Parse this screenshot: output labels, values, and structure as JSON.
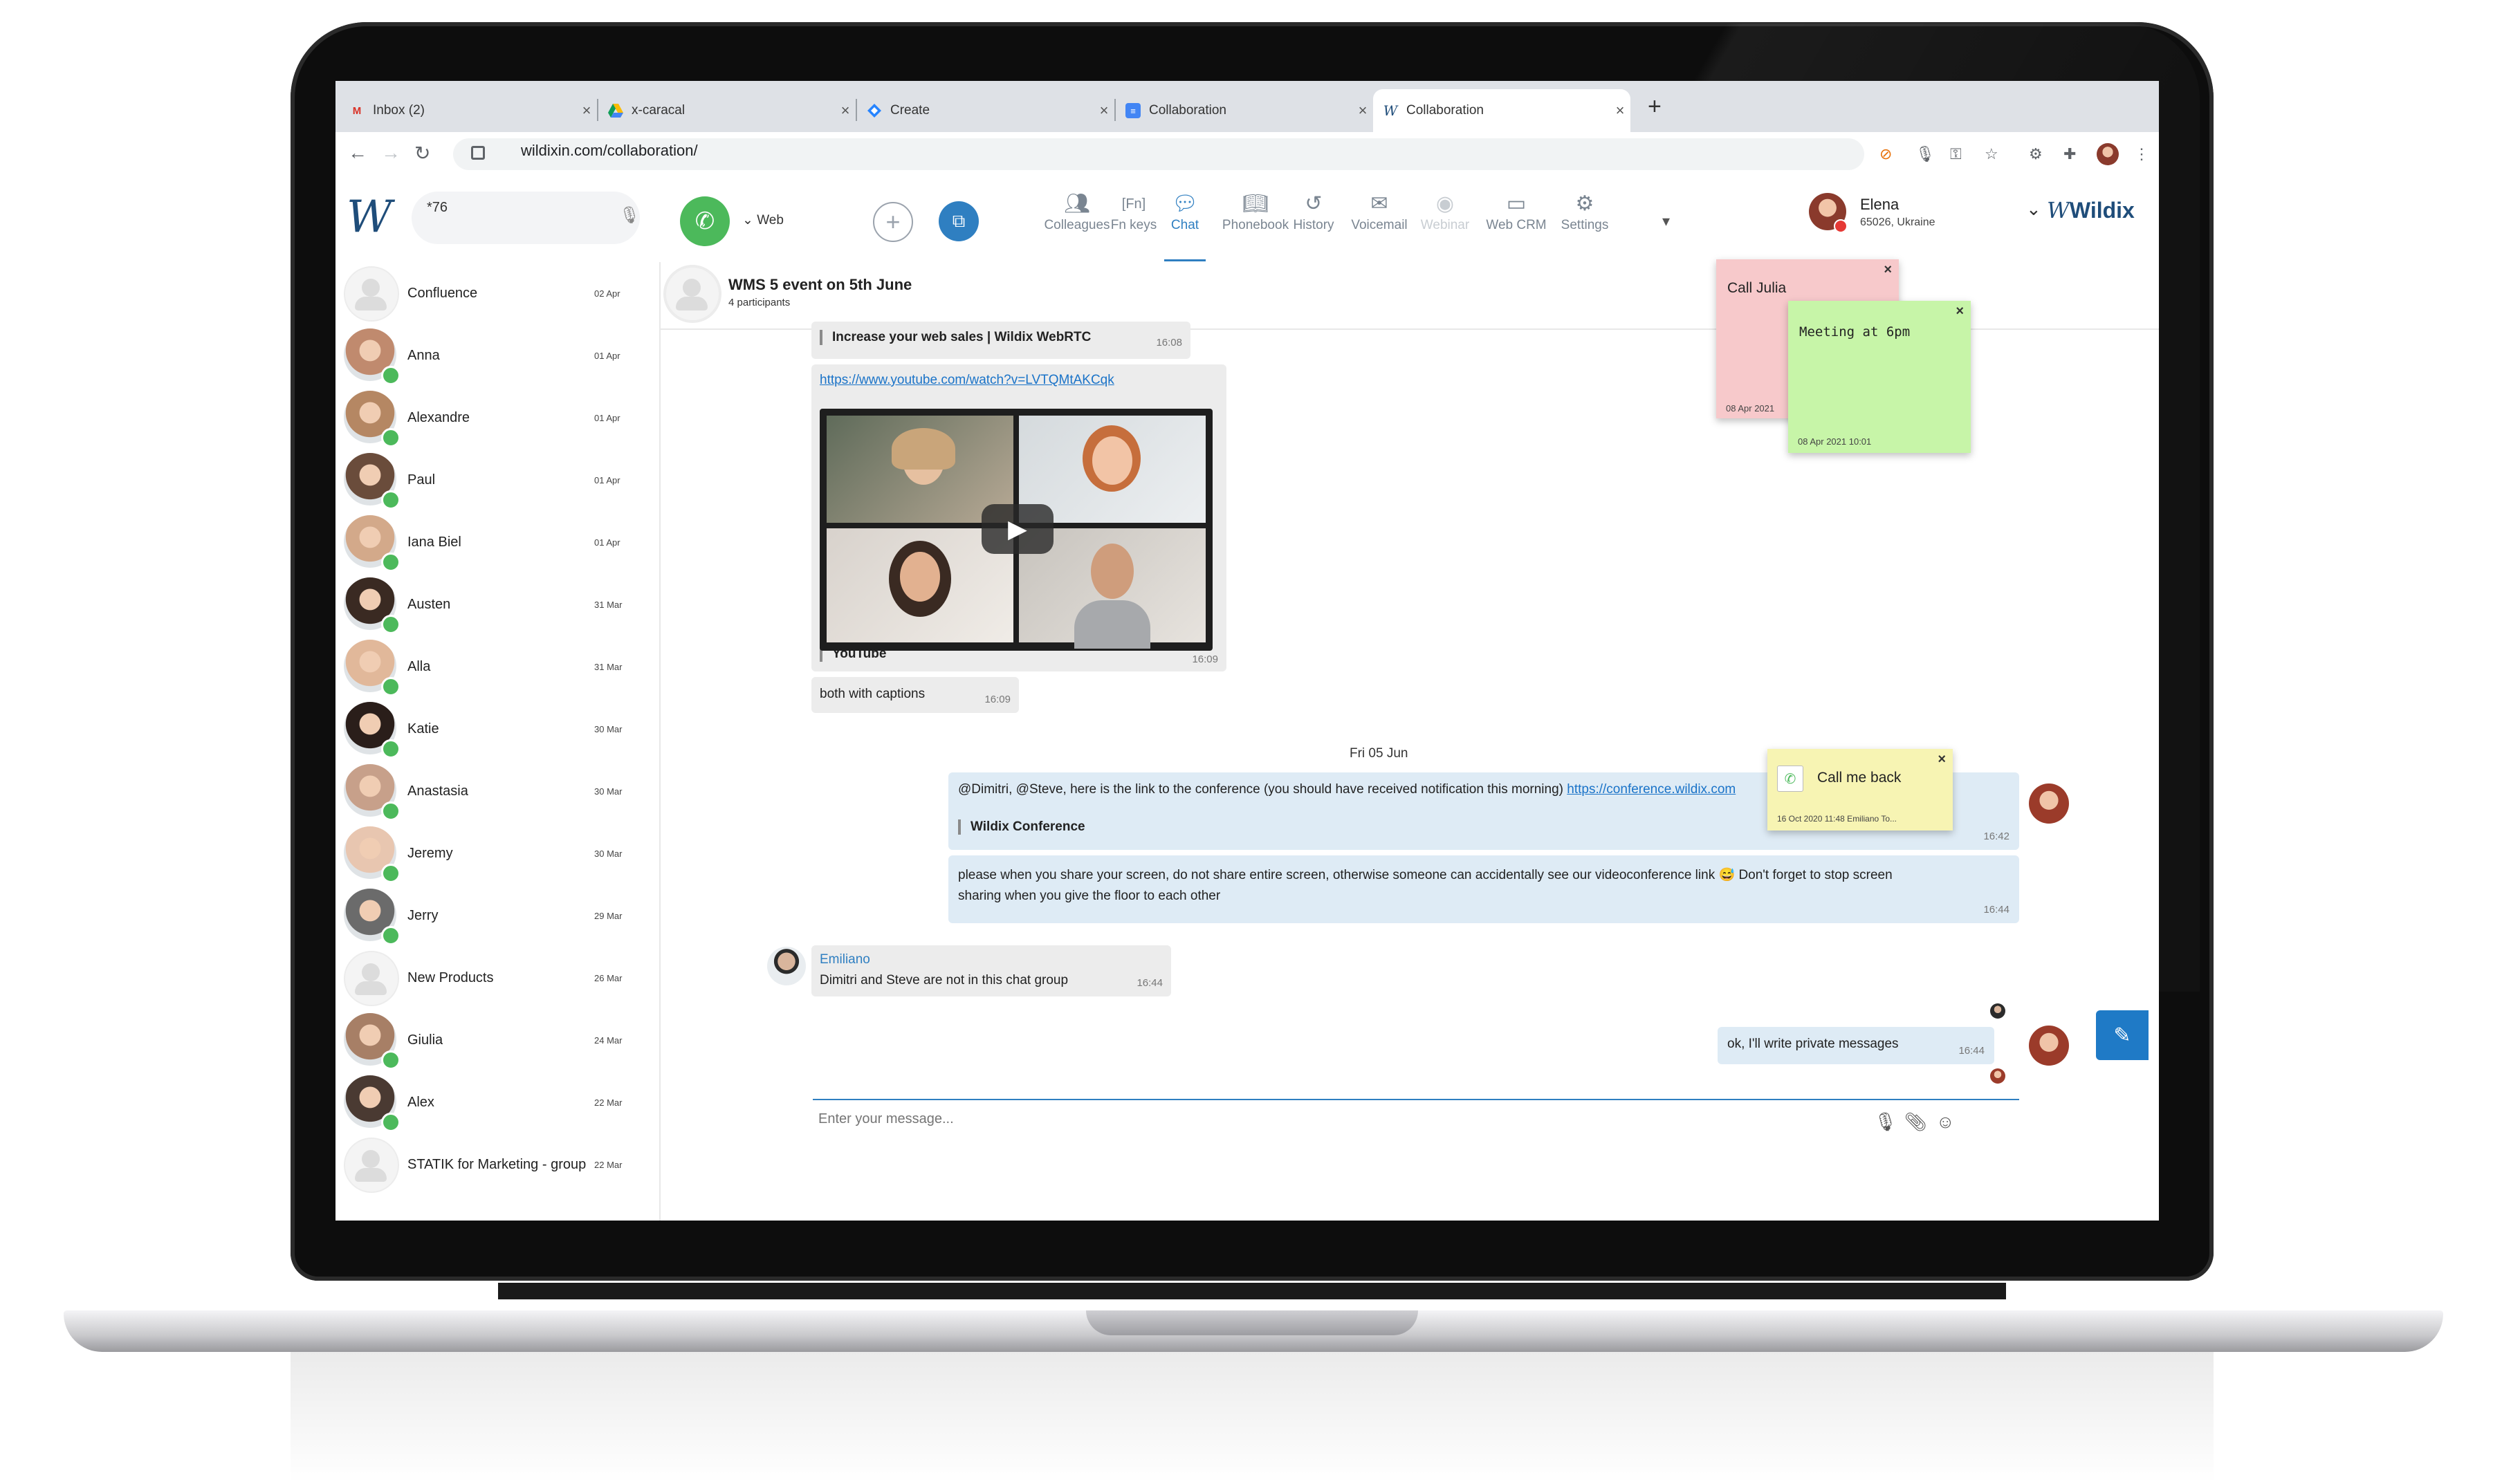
{
  "browser": {
    "tabs": [
      {
        "label": "Inbox (2)",
        "icon": "gmail-icon"
      },
      {
        "label": "x-caracal",
        "icon": "drive-icon"
      },
      {
        "label": "Create",
        "icon": "jira-icon"
      },
      {
        "label": "Collaboration",
        "icon": "docs-icon"
      },
      {
        "label": "Collaboration",
        "icon": "wildix-icon"
      }
    ],
    "new_tab": "+",
    "url": "wildixin.com/collaboration/"
  },
  "header": {
    "dial_value": "*76",
    "web_label": "Web",
    "nav": [
      {
        "label": "Colleagues",
        "icon": "colleagues-icon"
      },
      {
        "label": "Fn keys",
        "icon": "fn-keys-icon"
      },
      {
        "label": "Chat",
        "icon": "chat-icon"
      },
      {
        "label": "Phonebook",
        "icon": "phonebook-icon"
      },
      {
        "label": "History",
        "icon": "history-icon"
      },
      {
        "label": "Voicemail",
        "icon": "voicemail-icon"
      },
      {
        "label": "Webinar",
        "icon": "webinar-icon"
      },
      {
        "label": "Web CRM",
        "icon": "web-crm-icon"
      },
      {
        "label": "Settings",
        "icon": "settings-icon"
      }
    ],
    "user": {
      "name": "Elena",
      "ext": "65026, Ukraine",
      "status_color": "#e53935"
    },
    "brand": "Wildix"
  },
  "contacts": [
    {
      "name": "Confluence",
      "date": "02 Apr",
      "group": true
    },
    {
      "name": "Anna",
      "date": "01 Apr"
    },
    {
      "name": "Alexandre",
      "date": "01 Apr"
    },
    {
      "name": "Paul",
      "date": "01 Apr"
    },
    {
      "name": "Iana Biel",
      "date": "01 Apr"
    },
    {
      "name": "Austen",
      "date": "31 Mar"
    },
    {
      "name": "Alla",
      "date": "31 Mar"
    },
    {
      "name": "Katie",
      "date": "30 Mar"
    },
    {
      "name": "Anastasia",
      "date": "30 Mar"
    },
    {
      "name": "Jeremy",
      "date": "30 Mar"
    },
    {
      "name": "Jerry",
      "date": "29 Mar"
    },
    {
      "name": "New Products",
      "date": "26 Mar",
      "group": true
    },
    {
      "name": "Giulia",
      "date": "24 Mar"
    },
    {
      "name": "Alex",
      "date": "22 Mar"
    },
    {
      "name": "STATIK for Marketing - group",
      "date": "22 Mar",
      "group": true
    }
  ],
  "chat": {
    "title": "WMS 5 event on 5th June",
    "participants": "4 participants",
    "messages": {
      "m1_quote": "Increase your web sales | Wildix WebRTC",
      "m1_time": "16:08",
      "m2_link": "https://www.youtube.com/watch?v=LVTQMtAKCqk",
      "m2_quote": "YouTube",
      "m2_time": "16:09",
      "m3_text": "both with captions",
      "m3_time": "16:09",
      "date_sep": "Fri 05 Jun",
      "m4_text": "@Dimitri, @Steve, here is the link to the conference (you should have received notification this morning)",
      "m4_link": "https://conference.wildix.com",
      "m4_quote": "Wildix Conference",
      "m4_time": "16:42",
      "m5_text_a": "please when you share your screen, do not share entire screen, otherwise someone can accidentally see our videoconference link",
      "m5_emoji": "😅",
      "m5_text_b": "Don't forget to stop screen sharing when you give the floor to each other",
      "m5_time": "16:44",
      "m6_sender": "Emiliano",
      "m6_text": "Dimitri and Steve are not in this chat group",
      "m6_time": "16:44",
      "m7_text": "ok, I'll write private messages",
      "m7_time": "16:44"
    },
    "input_placeholder": "Enter your message..."
  },
  "notes": [
    {
      "title": "Call Julia",
      "date": "08 Apr 2021",
      "color": "#f7c9cb"
    },
    {
      "title": "Meeting at 6pm",
      "date": "08 Apr 2021 10:01",
      "color": "#c7f5a8"
    },
    {
      "title": "Call me back",
      "date": "16 Oct 2020 11:48  Emiliano To...",
      "color": "#f7f4b3"
    }
  ]
}
